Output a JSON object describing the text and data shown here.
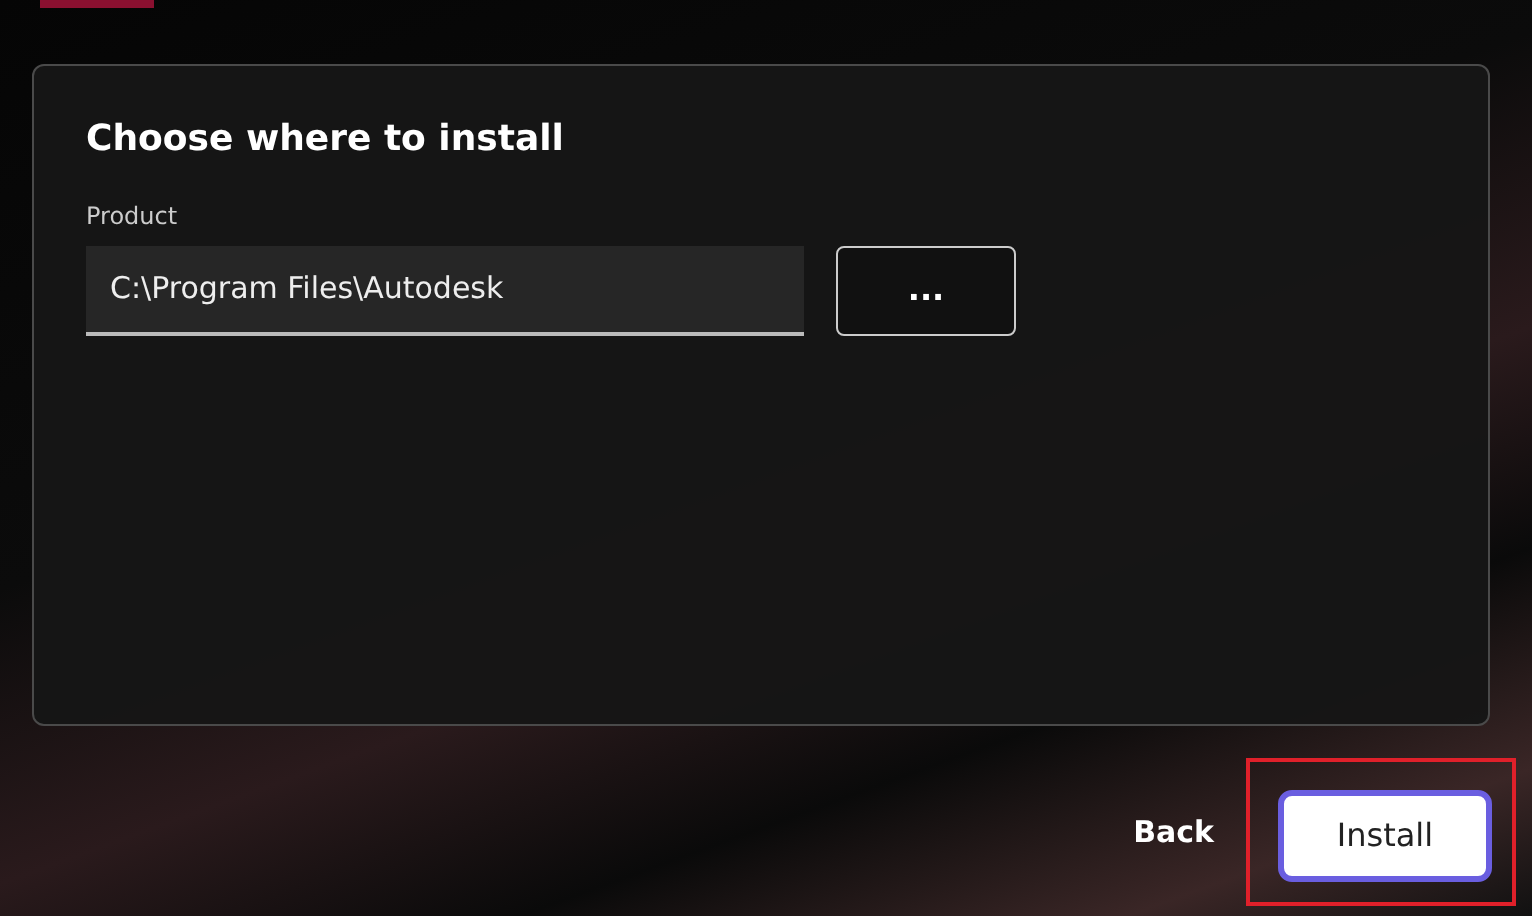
{
  "panel": {
    "title": "Choose where to install",
    "field": {
      "label": "Product",
      "value": "C:\\Program Files\\Autodesk"
    },
    "browse_button": "..."
  },
  "footer": {
    "back": "Back",
    "install": "Install",
    "install_highlighted": true
  }
}
